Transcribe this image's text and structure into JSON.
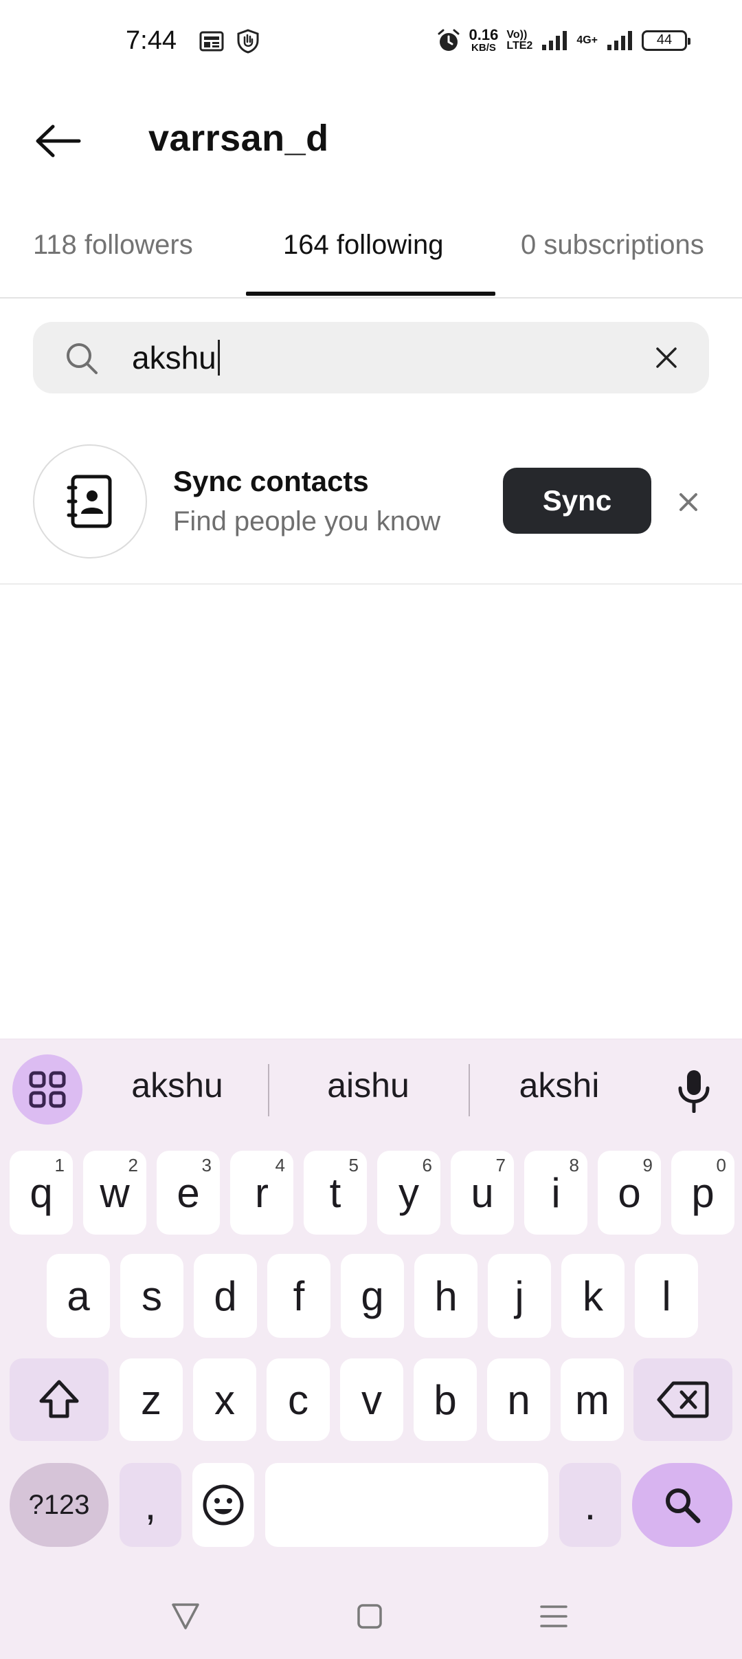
{
  "status_bar": {
    "time": "7:44",
    "net_speed_value": "0.16",
    "net_speed_unit": "KB/S",
    "volte_top": "Vo))",
    "volte_bottom": "LTE2",
    "network_type": "4G+",
    "battery": "44"
  },
  "header": {
    "title": "varrsan_d"
  },
  "tabs": [
    {
      "label": "118 followers"
    },
    {
      "label": "164 following"
    },
    {
      "label": "0 subscriptions"
    }
  ],
  "search": {
    "value": "akshu"
  },
  "sync": {
    "title": "Sync contacts",
    "subtitle": "Find people you know",
    "button": "Sync"
  },
  "keyboard": {
    "suggestions": [
      "akshu",
      "aishu",
      "akshi"
    ],
    "row1": [
      "q",
      "w",
      "e",
      "r",
      "t",
      "y",
      "u",
      "i",
      "o",
      "p"
    ],
    "row1_hints": [
      "1",
      "2",
      "3",
      "4",
      "5",
      "6",
      "7",
      "8",
      "9",
      "0"
    ],
    "row2": [
      "a",
      "s",
      "d",
      "f",
      "g",
      "h",
      "j",
      "k",
      "l"
    ],
    "row3": [
      "z",
      "x",
      "c",
      "v",
      "b",
      "n",
      "m"
    ],
    "symbols_key": "?123",
    "comma_key": ",",
    "period_key": "."
  },
  "colors": {
    "sync_button_bg": "#26282c",
    "keyboard_bg": "#f4ebf4",
    "keyboard_accent": "#d8b4f0",
    "search_bg": "#efefef"
  }
}
